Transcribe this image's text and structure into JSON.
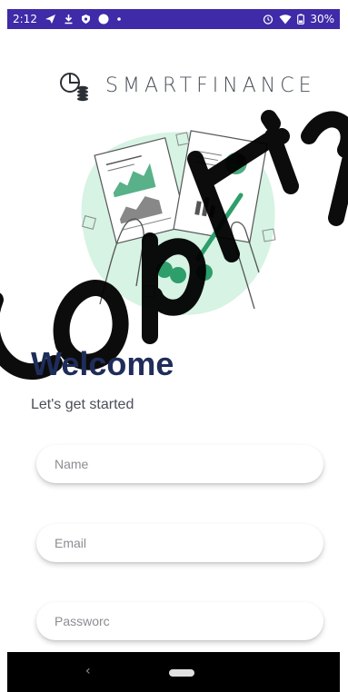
{
  "status_bar": {
    "time": "2:12",
    "battery": "30%",
    "icons": [
      "send-icon",
      "download-icon",
      "shield-icon",
      "circle-icon",
      "dot-icon",
      "alarm-icon",
      "wifi-icon",
      "battery-icon"
    ]
  },
  "logo": {
    "text": "SMARTFINANCE",
    "icon": "finance-logo-icon"
  },
  "illustration": {
    "icon": "finance-documents-illustration",
    "colors": {
      "accent": "#2e9e6a",
      "blob": "#d6f3e4"
    }
  },
  "welcome": {
    "title": "Welcome",
    "subtitle": "Let's get started"
  },
  "form": {
    "name_placeholder": "Name",
    "email_placeholder": "Email",
    "password_placeholder": "Passworc"
  },
  "nav": {
    "back_glyph": "‹"
  },
  "colors": {
    "status_bar": "#3f2aa8",
    "title": "#1f2d5a",
    "text": "#4a4f59",
    "nav_bar": "#000000"
  }
}
